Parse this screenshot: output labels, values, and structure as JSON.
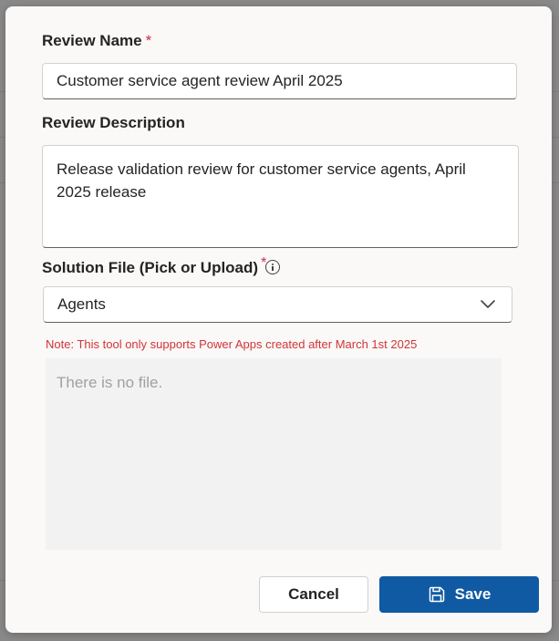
{
  "form": {
    "review_name_label": "Review Name",
    "review_name_required": "*",
    "review_name_value": "Customer service agent review April 2025",
    "review_description_label": "Review Description",
    "review_description_value": "Release validation review for customer service agents, April 2025 release",
    "solution_file_label": "Solution File (Pick or Upload)",
    "solution_file_required": "*",
    "solution_file_selected": "Agents",
    "note": "Note: This tool only supports Power Apps created after March 1st 2025",
    "file_area_empty_text": "There is no file."
  },
  "icons": {
    "info": "info-icon",
    "chevron": "chevron-down-icon",
    "save": "save-icon"
  },
  "actions": {
    "cancel_label": "Cancel",
    "save_label": "Save"
  },
  "colors": {
    "primary": "#0f5aa3",
    "required": "#c4314b",
    "note": "#d13438",
    "dialog_bg": "#faf9f8",
    "backdrop": "#8a8a8a"
  }
}
